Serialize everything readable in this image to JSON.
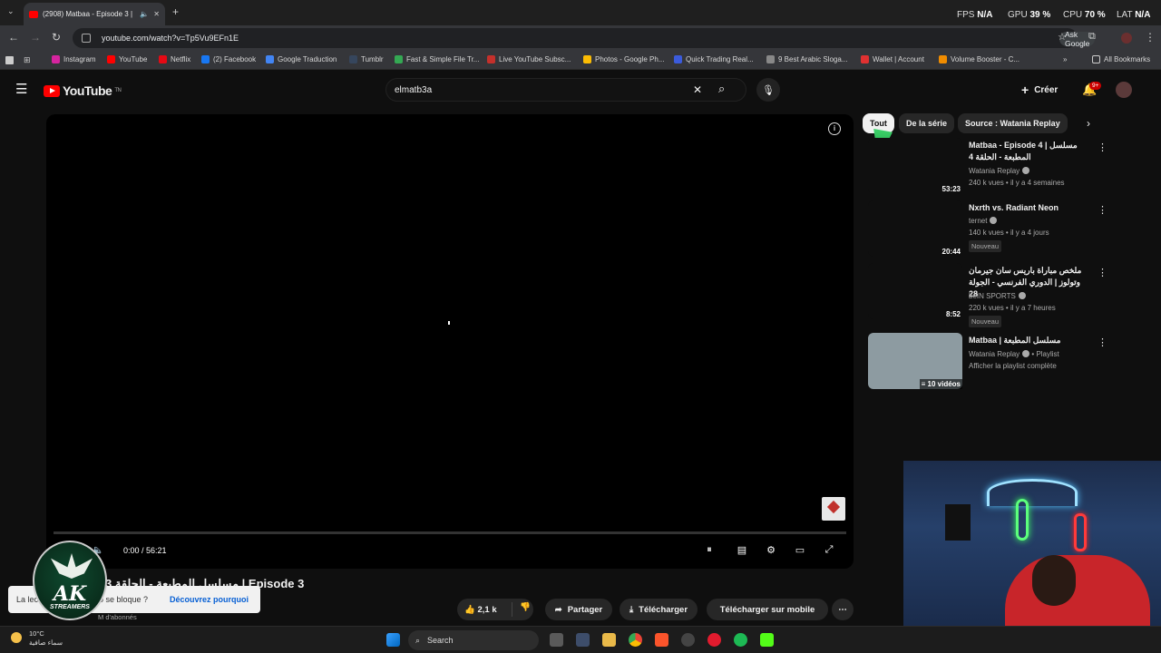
{
  "browser": {
    "tab_title": "(2908) Matbaa - Episode 3 |",
    "url": "youtube.com/watch?v=Tp5Vu9EFn1E",
    "ask_google": "Ask Google",
    "perf": {
      "fps_label": "FPS",
      "fps_value": "N/A",
      "gpu_label": "GPU",
      "gpu_value": "39 %",
      "cpu_label": "CPU",
      "cpu_value": "70 %",
      "lat_label": "LAT",
      "lat_value": "N/A"
    },
    "bookmarks": [
      {
        "label": "Instagram",
        "icon": "instagram-icon",
        "color": "#d6249f"
      },
      {
        "label": "YouTube",
        "icon": "youtube-icon",
        "color": "#ff0000"
      },
      {
        "label": "Netflix",
        "icon": "netflix-icon",
        "color": "#e50914"
      },
      {
        "label": "(2) Facebook",
        "icon": "facebook-icon",
        "color": "#1877f2"
      },
      {
        "label": "Google Traduction",
        "icon": "translate-icon",
        "color": "#4285f4"
      },
      {
        "label": "Tumblr",
        "icon": "tumblr-icon",
        "color": "#36465d"
      },
      {
        "label": "Fast & Simple File Tr...",
        "icon": "file-transfer-icon",
        "color": "#34a853"
      },
      {
        "label": "Live YouTube Subsc...",
        "icon": "youtube-icon",
        "color": "#c4302b"
      },
      {
        "label": "Photos - Google Ph...",
        "icon": "photos-icon",
        "color": "#fbbc04"
      },
      {
        "label": "Quick Trading Real...",
        "icon": "trading-icon",
        "color": "#3b5bdb"
      },
      {
        "label": "9 Best Arabic Sloga...",
        "icon": "link-icon",
        "color": "#888888"
      },
      {
        "label": "Wallet | Account",
        "icon": "wallet-icon",
        "color": "#e03131"
      },
      {
        "label": "Volume Booster - C...",
        "icon": "volume-icon",
        "color": "#f08c00"
      }
    ],
    "all_bookmarks": "All Bookmarks"
  },
  "yt": {
    "logo_text": "YouTube",
    "logo_sup": "TN",
    "search_value": "elmatb3a",
    "create": "Créer",
    "notif_badge": "9+"
  },
  "player": {
    "time": "0:00 / 56:21",
    "progress_fraction": 0.0
  },
  "video": {
    "title": "مسلسل المطبعة - الحلقة 3 | Episode 3",
    "subscribers": "M d'abonnés",
    "toast_left": "La lecture de la vidéo se bloque ?",
    "toast_left_visible": "La lec",
    "toast_mid": "o se bloque ?",
    "toast_link": "Découvrez pourquoi",
    "likes": "2,1 k",
    "share": "Partager",
    "download": "Télécharger",
    "mobile": "Télécharger sur mobile",
    "channel_logo_text": "AK",
    "channel_logo_sub": "STREAMERS"
  },
  "chips": [
    "Tout",
    "De la série",
    "Source : Watania Replay"
  ],
  "side_videos": [
    {
      "title": "Matbaa - Episode 4 | مسلسل المطبعة - الحلقة 4",
      "channel": "Watania Replay",
      "meta": "240 k vues • il y a 4 semaines",
      "duration": "53:23",
      "badge": ""
    },
    {
      "title": "Nxrth vs. Radiant Neon",
      "channel": "ternet",
      "meta": "140 k vues • il y a 4 jours",
      "duration": "20:44",
      "badge": "Nouveau"
    },
    {
      "title": "ملخص مباراة باريس سان جيرمان وتولوز | الدوري الفرنسي - الجولة 28",
      "channel": "beIN SPORTS",
      "meta": "220 k vues • il y a 7 heures",
      "duration": "8:52",
      "badge": "Nouveau"
    }
  ],
  "playlist": {
    "title": "Matbaa | مسلسل المطبعة",
    "channel": "Watania Replay",
    "kind": "Playlist",
    "link": "Afficher la playlist complète",
    "count": "10 vidéos"
  },
  "taskbar": {
    "temp": "10°C",
    "weather": "سماء صافية",
    "search": "Search"
  }
}
